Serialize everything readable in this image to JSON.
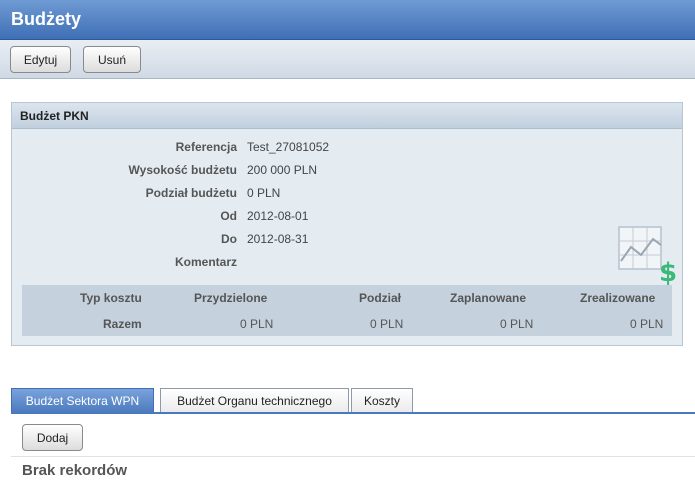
{
  "window": {
    "title": "Budżety"
  },
  "toolbar": {
    "edit_label": "Edytuj",
    "delete_label": "Usuń"
  },
  "panel": {
    "title": "Budżet PKN",
    "fields": [
      {
        "label": "Referencja",
        "value": "Test_27081052"
      },
      {
        "label": "Wysokość budżetu",
        "value": "200 000 PLN"
      },
      {
        "label": "Podział budżetu",
        "value": "0 PLN"
      },
      {
        "label": "Od",
        "value": "2012-08-01"
      },
      {
        "label": "Do",
        "value": "2012-08-31"
      },
      {
        "label": "Komentarz",
        "value": ""
      }
    ],
    "summary": {
      "headers": [
        "Typ kosztu",
        "Przydzielone",
        "Podział",
        "Zaplanowane",
        "Zrealizowane"
      ],
      "row": [
        "Razem",
        "0 PLN",
        "0 PLN",
        "0 PLN",
        "0 PLN"
      ]
    },
    "icon": "budget-chart-dollar-icon",
    "accent_green": "#3cb878"
  },
  "tabs": [
    {
      "label": "Budżet Sektora WPN",
      "active": true
    },
    {
      "label": "Budżet Organu technicznego",
      "active": false
    },
    {
      "label": "Koszty",
      "active": false
    }
  ],
  "tab_content": {
    "add_label": "Dodaj",
    "empty_text": "Brak rekordów"
  },
  "colors": {
    "header_blue": "#4a79bd",
    "panel_bg": "#e4ecf2"
  }
}
